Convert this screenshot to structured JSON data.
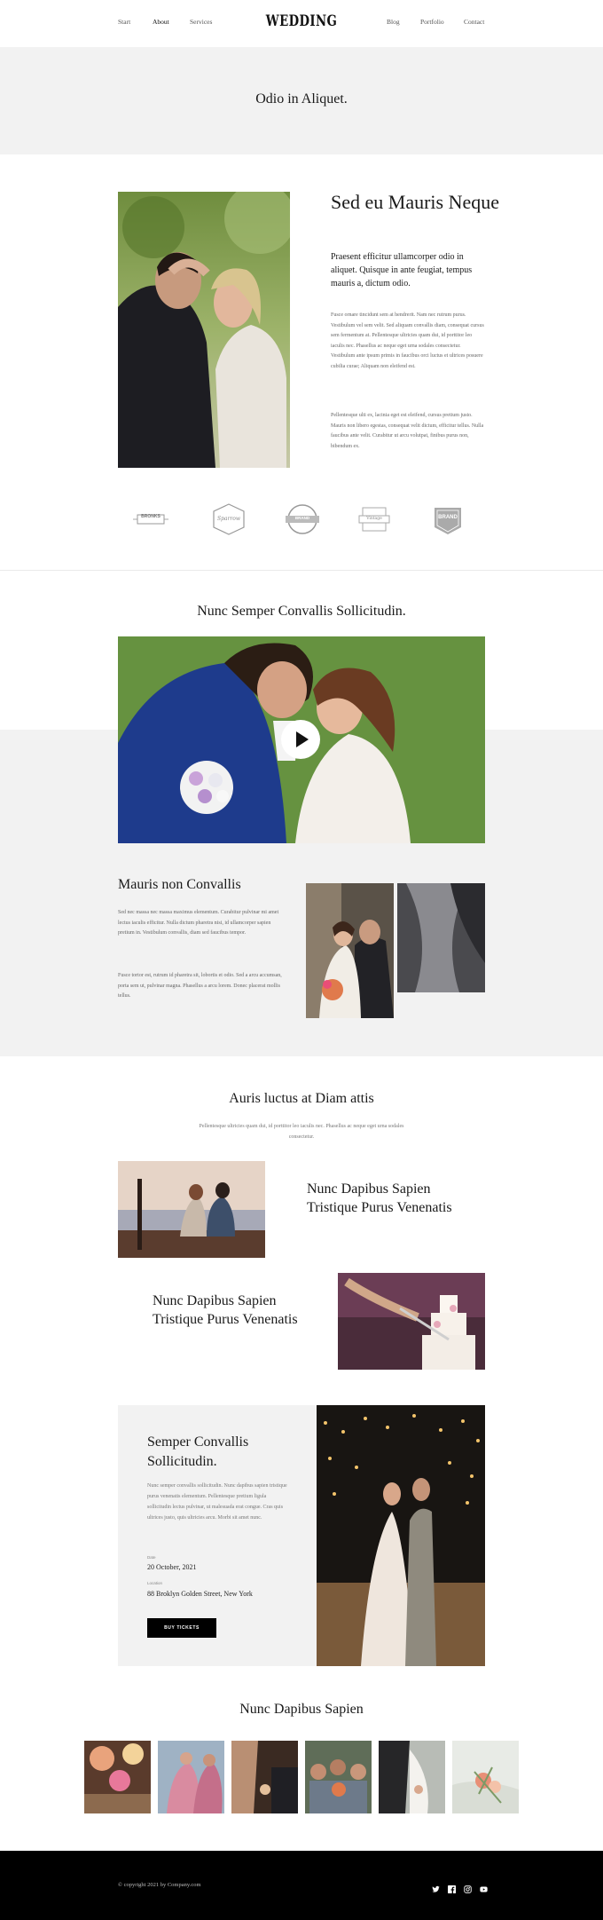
{
  "nav": {
    "left": [
      "Start",
      "About",
      "Services"
    ],
    "logo": "WEDDING",
    "right": [
      "Blog",
      "Portfolio",
      "Contact"
    ]
  },
  "hero": {
    "title": "Odio in Aliquet."
  },
  "section1": {
    "title": "Sed eu Mauris Neque",
    "lead": "Praesent efficitur ullamcorper odio in aliquet. Quisque in ante feugiat, tempus mauris a, dictum odio.",
    "p1": "Fusce ornare tincidunt sem at hendrerit. Nam nec rutrum purus. Vestibulum vel sem velit. Sed aliquam convallis diam, consequat cursus sem fermentum at. Pellentesque ultricies quam dui, id porttitor leo iaculis nec. Phasellus ac neque eget urna sodales consectetur. Vestibulum ante ipsum primis in faucibus orci luctus et ultrices posuere cubilia curae; Aliquam non eleifend est.",
    "p2": "Pellentesque ulti ex, lacinia eget est eleifend, cursus pretium justo. Mauris non libero egestas, consequat velit dictum, efficitur tellus. Nulla faucibus ante velit. Curabitur ut arcu volutpat, finibus purus non, bibendum ex."
  },
  "brands": [
    "BRONKS",
    "Sparrow",
    "BRAND",
    "Vintage",
    "BRAND"
  ],
  "section2": {
    "title": "Nunc Semper Convallis Sollicitudin."
  },
  "section3": {
    "title": "Mauris non Convallis",
    "p1": "Sed nec massa nec massa maximus elementum. Curabitur pulvinar mi amet lectus iaculis efficitur. Nulla dictum pharetra nisi, id ullamcorper sapien pretium in. Vestibulum convallis, diam sed faucibus tempor.",
    "p2": "Fusce tortor est, rutrum id pharetra sit, lobortis et odio. Sed a arcu accumsan, porta sem ut, pulvinar magna. Phasellus a arcu lorem. Donec placerat mollis tellus."
  },
  "section4": {
    "title": "Auris luctus at Diam attis",
    "subtitle": "Pellentesque ultricies quam dui, id porttitor leo iaculis nec. Phasellus ac neque eget urna sodales consectetur.",
    "feature1": "Nunc Dapibus Sapien Tristique Purus Venenatis",
    "feature2": "Nunc Dapibus Sapien Tristique Purus Venenatis"
  },
  "event": {
    "title": "Semper Convallis Sollicitudin.",
    "text": "Nunc semper convallis sollicitudin. Nunc dapibus sapien tristique purus venenatis elementum. Pellentesque pretium ligula sollicitudin lectus pulvinar, ut malesuada erat congue. Cras quis ultrices justo, quis ultricies arcu. Morbi sit amet nunc.",
    "date_label": "Date",
    "date": "20 October, 2021",
    "location_label": "Location",
    "location": "88 Broklyn Golden Street, New York",
    "button": "BUY TICKETS"
  },
  "gallery": {
    "title": "Nunc Dapibus Sapien"
  },
  "footer": {
    "copyright": "© copyright 2021 by Company.com",
    "social": [
      "twitter-icon",
      "facebook-icon",
      "instagram-icon",
      "youtube-icon"
    ]
  }
}
